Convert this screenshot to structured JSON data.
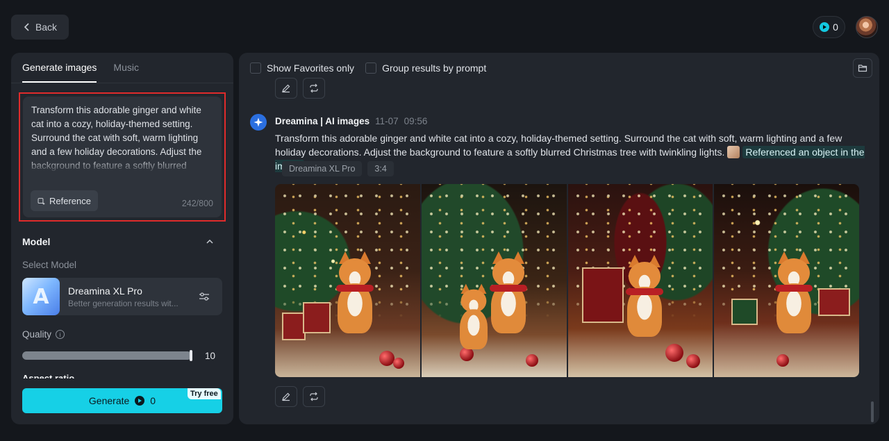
{
  "header": {
    "back_label": "Back",
    "credits": "0"
  },
  "left": {
    "tabs": [
      {
        "label": "Generate images",
        "active": true
      },
      {
        "label": "Music",
        "active": false
      }
    ],
    "prompt": {
      "text": "Transform this adorable ginger and white cat into a cozy, holiday-themed setting. Surround the cat with soft, warm lighting and a few holiday decorations. Adjust the background to feature a softly blurred Christmas tree with twinkling lights.",
      "reference_label": "Reference",
      "char_count": "242/800"
    },
    "model_section": {
      "title": "Model",
      "select_label": "Select Model",
      "model_name": "Dreamina XL Pro",
      "model_desc": "Better generation results wit...",
      "thumb_letter": "A"
    },
    "quality": {
      "label": "Quality",
      "value": "10",
      "fill": 1.0
    },
    "clipped_label": "Aspect ratio",
    "generate": {
      "label": "Generate",
      "cost": "0",
      "badge": "Try free"
    }
  },
  "right": {
    "show_favorites_label": "Show Favorites only",
    "group_results_label": "Group results by prompt",
    "message": {
      "author": "Dreamina | AI images",
      "date": "11-07",
      "time": "09:56",
      "text": "Transform this adorable ginger and white cat into a cozy, holiday-themed setting. Surround the cat with soft, warm lighting and a few holiday decorations. Adjust the background to feature a softly blurred Christmas tree with twinkling lights.",
      "reference_tag": "Referenced an object in the image",
      "model_tag": "Dreamina XL Pro",
      "ratio_tag": "3:4"
    }
  },
  "colors": {
    "accent": "#16d0e6",
    "panel": "#22262d",
    "background": "#14171c",
    "highlight_border": "#e02b2b"
  }
}
